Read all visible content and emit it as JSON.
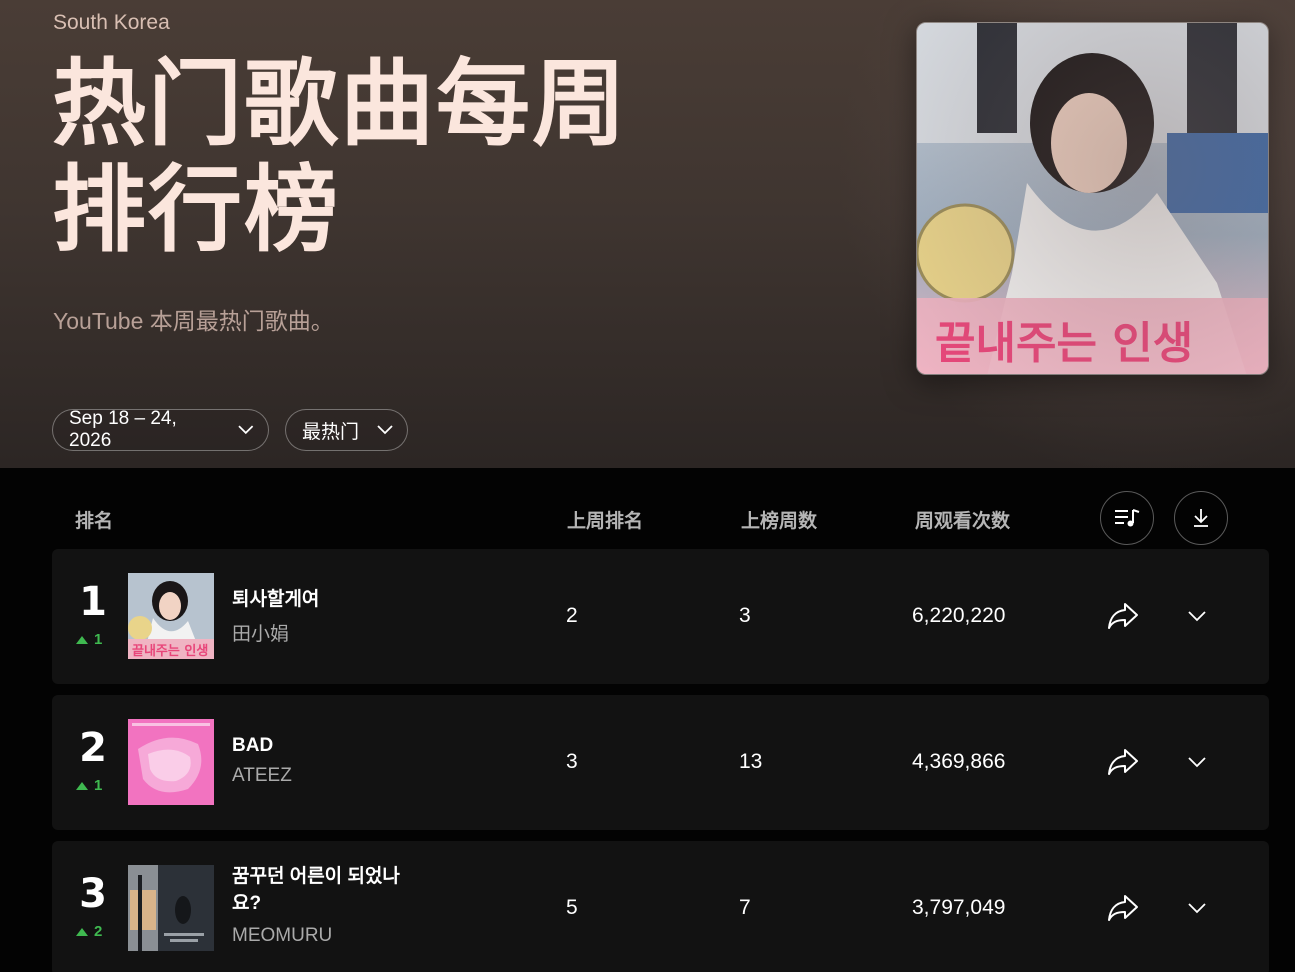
{
  "hero": {
    "country": "South Korea",
    "title": "热门歌曲每周排行榜",
    "subtitle": "YouTube 本周最热门歌曲。",
    "date_range": "Sep 18 – 24, 2026",
    "sort": "最热门"
  },
  "table": {
    "headers": {
      "rank": "排名",
      "last_week": "上周排名",
      "weeks_on_chart": "上榜周数",
      "weekly_views": "周观看次数"
    },
    "rows": [
      {
        "rank": "1",
        "change": "1",
        "title": "퇴사할게여",
        "artist": "田小娟",
        "last_week": "2",
        "weeks": "3",
        "views": "6,220,220"
      },
      {
        "rank": "2",
        "change": "1",
        "title": "BAD",
        "artist": "ATEEZ",
        "last_week": "3",
        "weeks": "13",
        "views": "4,369,866"
      },
      {
        "rank": "3",
        "change": "2",
        "title": "꿈꾸던 어른이 되었나요?",
        "artist": "MEOMURU",
        "last_week": "5",
        "weeks": "7",
        "views": "3,797,049"
      }
    ]
  },
  "cover_art_text": "끝내주는 인생",
  "colors": {
    "hero_title": "#fbe6dd",
    "rank_up": "#3fb950",
    "row_bg": "#121212",
    "page_bg": "#030303"
  },
  "icons": {
    "playlist": "playlist-music-icon",
    "download": "download-icon",
    "share": "share-arrow-icon",
    "expand": "chevron-down-icon"
  }
}
